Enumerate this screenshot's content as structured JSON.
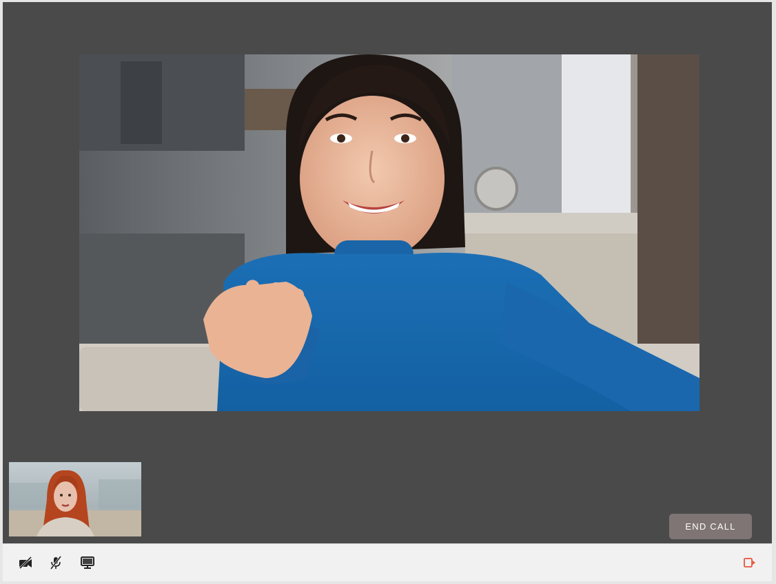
{
  "call": {
    "end_call_label": "END CALL"
  },
  "remote_participant": {
    "video_description": "remote-video-feed"
  },
  "local_participant": {
    "video_description": "self-preview-feed"
  },
  "toolbar": {
    "icons": {
      "camera": "camera-off-icon",
      "mic": "mic-off-icon",
      "screen": "screen-share-icon",
      "leave": "leave-call-icon"
    }
  },
  "colors": {
    "stage_background": "#4a4a4a",
    "end_call_button": "#7f7574",
    "toolbar_background": "#f1f1f1",
    "leave_icon": "#e8553c"
  }
}
